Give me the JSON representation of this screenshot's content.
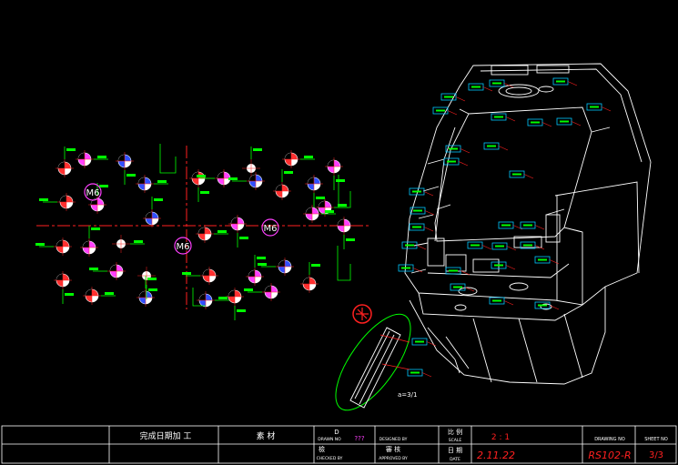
{
  "drawing": {
    "m6_labels": [
      "M6",
      "M6",
      "M6"
    ],
    "scale_note": "a=3/1"
  },
  "title_block": {
    "cells": [
      {
        "key": "process",
        "text": "完成日期加 工"
      },
      {
        "key": "material",
        "text": "素 材"
      },
      {
        "key": "drawn_cn",
        "text": "D"
      },
      {
        "key": "drawn_en",
        "text": "DRAWN NO"
      },
      {
        "key": "drawn_val",
        "text": "???"
      },
      {
        "key": "checked_cn",
        "text": "檢"
      },
      {
        "key": "checked_en",
        "text": "CHECKED BY"
      },
      {
        "key": "designed_en",
        "text": "DESIGNED BY"
      },
      {
        "key": "approved_cn",
        "text": "審 核"
      },
      {
        "key": "approved_en",
        "text": "APPROVED BY"
      },
      {
        "key": "scale_cn",
        "text": "比 例"
      },
      {
        "key": "scale_en",
        "text": "SCALE"
      },
      {
        "key": "scale_val",
        "text": "2 : 1"
      },
      {
        "key": "date_cn",
        "text": "日 期"
      },
      {
        "key": "date_en",
        "text": "DATE"
      },
      {
        "key": "date_val",
        "text": "2.11.22"
      },
      {
        "key": "drawing_no_en",
        "text": "DRAWING NO"
      },
      {
        "key": "drawing_no_val",
        "text": "RS102-R"
      },
      {
        "key": "sheet_en",
        "text": "SHEET NO"
      },
      {
        "key": "sheet_val",
        "text": "3/3"
      }
    ]
  },
  "colors": {
    "background": "#000000",
    "cad_line": "#ffffff",
    "centerline": "#ff0000",
    "dimension": "#00ff00",
    "leader": "#ff2020",
    "label_box": "#00c8ff",
    "highlight": "#ffff00",
    "hole_fill_a": "#ff3030",
    "hole_fill_b": "#ff40ff",
    "hole_fill_c": "#3050ff"
  }
}
